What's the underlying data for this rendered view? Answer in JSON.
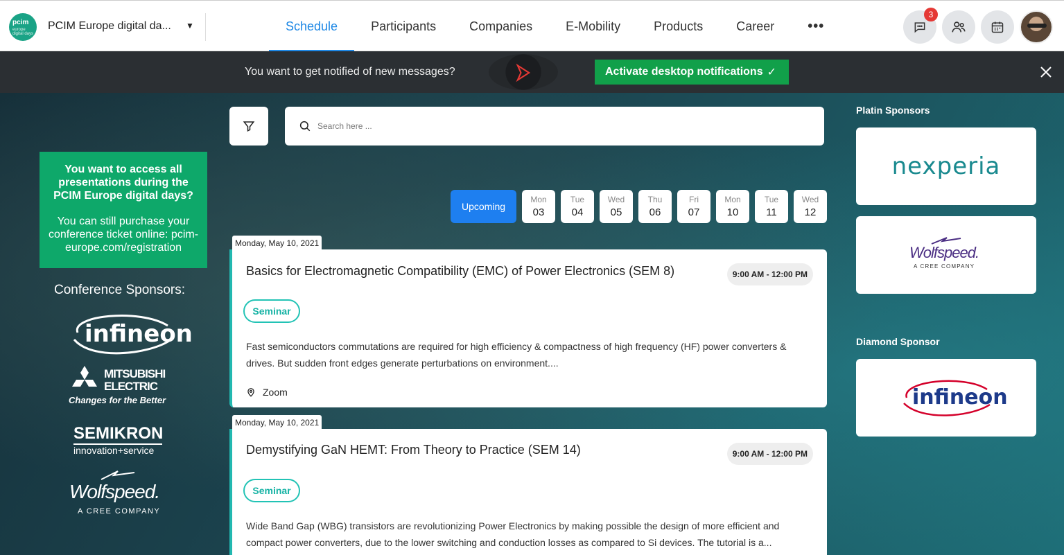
{
  "app": {
    "logo_text": "pcim",
    "logo_sub": "europe digital days",
    "event_name": "PCIM Europe digital da..."
  },
  "nav": {
    "tabs": [
      {
        "label": "Schedule",
        "active": true
      },
      {
        "label": "Participants"
      },
      {
        "label": "Companies"
      },
      {
        "label": "E-Mobility"
      },
      {
        "label": "Products"
      },
      {
        "label": "Career"
      }
    ],
    "more": "•••"
  },
  "header_actions": {
    "messages_badge": "3"
  },
  "notification": {
    "text": "You want to get notified of new messages?",
    "cta": "Activate desktop notifications",
    "cta_check": "✓"
  },
  "promo": {
    "title": "You want to access all presentations during the PCIM Europe digital days?",
    "body": "You can still purchase your conference ticket online: pcim-europe.com/registration"
  },
  "conference_sponsors": {
    "heading": "Conference Sponsors:",
    "logos": [
      "infineon",
      "mitsubishi-electric",
      "semikron",
      "wolfspeed"
    ]
  },
  "search": {
    "placeholder": "Search here ..."
  },
  "date_filter": {
    "upcoming_label": "Upcoming",
    "days": [
      {
        "dow": "Mon",
        "num": "03"
      },
      {
        "dow": "Tue",
        "num": "04"
      },
      {
        "dow": "Wed",
        "num": "05"
      },
      {
        "dow": "Thu",
        "num": "06"
      },
      {
        "dow": "Fri",
        "num": "07"
      },
      {
        "dow": "Mon",
        "num": "10"
      },
      {
        "dow": "Tue",
        "num": "11"
      },
      {
        "dow": "Wed",
        "num": "12"
      }
    ]
  },
  "sessions": [
    {
      "date": "Monday, May 10, 2021",
      "title": "Basics for Electromagnetic Compatibility (EMC) of Power Electronics (SEM 8)",
      "time": "9:00 AM - 12:00 PM",
      "type": "Seminar",
      "description": "Fast semiconductors commutations are required for high efficiency & compactness of high frequency (HF) power converters & drives. But sudden front edges generate perturbations on environment....",
      "location": "Zoom"
    },
    {
      "date": "Monday, May 10, 2021",
      "title": "Demystifying GaN HEMT: From Theory to Practice (SEM 14)",
      "time": "9:00 AM - 12:00 PM",
      "type": "Seminar",
      "description": "Wide Band Gap (WBG) transistors are revolutionizing Power Electronics by making possible the design of more efficient and compact power converters, due to the lower switching and conduction losses as compared to Si devices. The tutorial is a..."
    }
  ],
  "sponsors": {
    "platin_heading": "Platin Sponsors",
    "diamond_heading": "Diamond Sponsor",
    "nexperia": "nexperia",
    "wolfspeed": "Wolfspeed.",
    "wolfspeed_tag": "A CREE COMPANY",
    "infineon": "infineon"
  },
  "left_logos": {
    "infineon": "infineon",
    "mitsubishi_line1": "MITSUBISHI",
    "mitsubishi_line2": "ELECTRIC",
    "mitsubishi_tag": "Changes for the Better",
    "semikron": "SEMIKRON",
    "semikron_tag": "innovation+service",
    "wolfspeed": "Wolfspeed.",
    "wolfspeed_tag": "A CREE COMPANY"
  },
  "colors": {
    "accent": "#1e88e5",
    "promo": "#0ea86a",
    "cta": "#11a04a",
    "seminar": "#22c3b5",
    "nexperia_orange": "#f39200",
    "nexperia_teal": "#1a8a8f",
    "infineon_red": "#d4002a",
    "infineon_blue": "#1d3a8a",
    "wolfspeed_purple": "#4b2e83"
  }
}
